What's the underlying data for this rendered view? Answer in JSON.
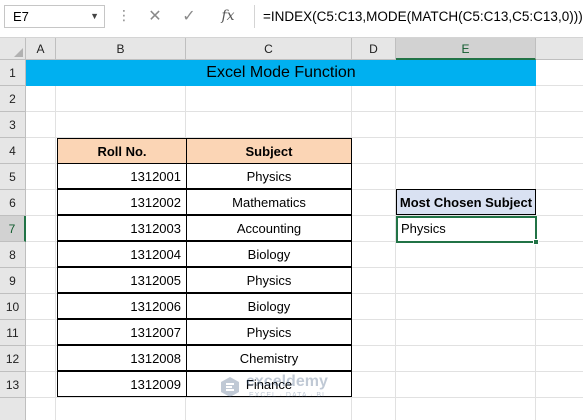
{
  "formula_bar": {
    "name_box": "E7",
    "cancel_icon": "✕",
    "enter_icon": "✓",
    "fx_label": "fx",
    "formula": "=INDEX(C5:C13,MODE(MATCH(C5:C13,C5:C13,0)))"
  },
  "columns": [
    "A",
    "B",
    "C",
    "D",
    "E"
  ],
  "rows": [
    "1",
    "2",
    "3",
    "4",
    "5",
    "6",
    "7",
    "8",
    "9",
    "10",
    "11",
    "12",
    "13"
  ],
  "title": "Excel Mode Function",
  "table": {
    "headers": [
      "Roll No.",
      "Subject"
    ],
    "rows": [
      {
        "roll": "1312001",
        "subject": "Physics"
      },
      {
        "roll": "1312002",
        "subject": "Mathematics"
      },
      {
        "roll": "1312003",
        "subject": "Accounting"
      },
      {
        "roll": "1312004",
        "subject": "Biology"
      },
      {
        "roll": "1312005",
        "subject": "Physics"
      },
      {
        "roll": "1312006",
        "subject": "Biology"
      },
      {
        "roll": "1312007",
        "subject": "Physics"
      },
      {
        "roll": "1312008",
        "subject": "Chemistry"
      },
      {
        "roll": "1312009",
        "subject": "Finance"
      }
    ]
  },
  "result": {
    "header": "Most Chosen Subject",
    "value": "Physics"
  },
  "watermark": {
    "brand": "exceldemy",
    "tagline": "EXCEL · DATA · BI"
  },
  "colors": {
    "title_fill": "#00b0f0",
    "table_header_fill": "#fbd5b5",
    "result_header_fill": "#d9e1f2",
    "selection": "#217346"
  }
}
